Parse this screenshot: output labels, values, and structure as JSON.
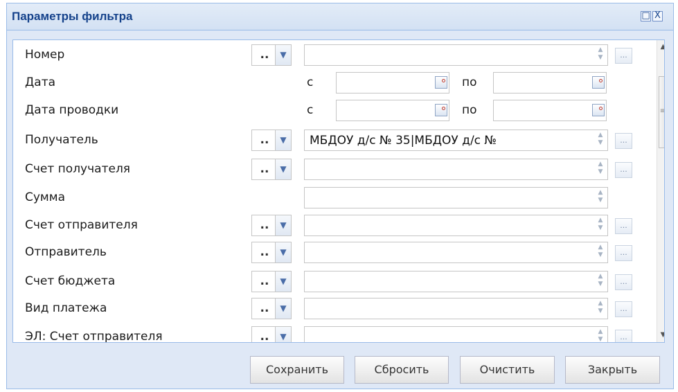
{
  "window": {
    "title": "Параметры фильтра",
    "maximize_icon": "□",
    "close_icon": "X"
  },
  "fields": [
    {
      "label": "Номер",
      "op": "..",
      "value": ""
    },
    {
      "label": "Дата",
      "from_label": "с",
      "to_label": "по",
      "from_value": "",
      "to_value": ""
    },
    {
      "label": "Дата проводки",
      "from_label": "с",
      "to_label": "по",
      "from_value": "",
      "to_value": ""
    },
    {
      "label": "Получатель",
      "op": "..",
      "value": "МБДОУ д/с № 35|МБДОУ д/с №"
    },
    {
      "label": "Счет получателя",
      "op": "..",
      "value": ""
    },
    {
      "label": "Сумма",
      "value": ""
    },
    {
      "label": "Счет отправителя",
      "op": "..",
      "value": ""
    },
    {
      "label": "Отправитель",
      "op": "..",
      "value": ""
    },
    {
      "label": "Счет бюджета",
      "op": "..",
      "value": ""
    },
    {
      "label": "Вид платежа",
      "op": "..",
      "value": ""
    },
    {
      "label": "ЭЛ: Счет отправителя",
      "op": "..",
      "value": ""
    }
  ],
  "glyphs": {
    "dropdown": "▼",
    "spinner_up": "▲",
    "spinner_down": "▼",
    "ellipsis": "...",
    "scroll_up": "▲",
    "scroll_down": "▼",
    "grip": "≡"
  },
  "buttons": {
    "save": "Сохранить",
    "reset": "Сбросить",
    "clear": "Очистить",
    "close": "Закрыть"
  }
}
